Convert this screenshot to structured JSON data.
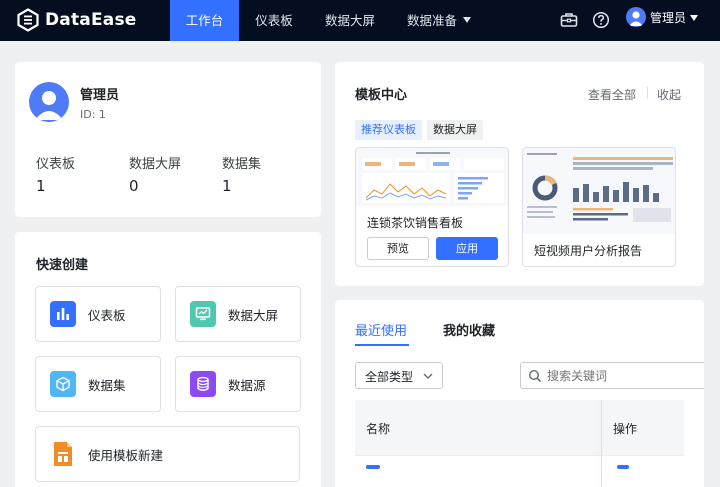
{
  "app": {
    "name": "DataEase"
  },
  "nav": {
    "items": [
      {
        "label": "工作台",
        "active": true
      },
      {
        "label": "仪表板",
        "active": false
      },
      {
        "label": "数据大屏",
        "active": false
      },
      {
        "label": "数据准备",
        "active": false
      }
    ],
    "icons": [
      "toolbox-icon",
      "help-icon"
    ],
    "user": {
      "name": "管理员"
    }
  },
  "profile": {
    "name": "管理员",
    "id_text": "ID: 1",
    "stats": [
      {
        "label": "仪表板",
        "value": "1"
      },
      {
        "label": "数据大屏",
        "value": "0"
      },
      {
        "label": "数据集",
        "value": "1"
      }
    ]
  },
  "quick_create": {
    "title": "快速创建",
    "items": [
      {
        "label": "仪表板",
        "icon": "dashboard-icon",
        "color": "#3370ff"
      },
      {
        "label": "数据大屏",
        "icon": "screen-icon",
        "color": "#4ec9b0"
      },
      {
        "label": "数据集",
        "icon": "dataset-icon",
        "color": "#51b6f5"
      },
      {
        "label": "数据源",
        "icon": "datasource-icon",
        "color": "#8b4bf0"
      },
      {
        "label": "使用模板新建",
        "icon": "template-icon",
        "color": "#f28c28"
      }
    ]
  },
  "templates": {
    "title": "模板中心",
    "view_all": "查看全部",
    "collapse": "收起",
    "tags": [
      {
        "label": "推荐仪表板",
        "active": true
      },
      {
        "label": "数据大屏",
        "active": false
      }
    ],
    "cards": [
      {
        "name": "连锁茶饮销售看板",
        "preview": "预览",
        "apply": "应用"
      },
      {
        "name": "短视频用户分析报告"
      }
    ]
  },
  "recent": {
    "tabs": [
      {
        "label": "最近使用",
        "active": true
      },
      {
        "label": "我的收藏",
        "active": false
      }
    ],
    "filter": {
      "value": "全部类型"
    },
    "search": {
      "placeholder": "搜索关键词"
    },
    "columns": [
      "名称",
      "操作"
    ]
  },
  "colors": {
    "accent": "#3370ff",
    "nav_bg": "#050e21",
    "page_bg": "#eff0f1"
  }
}
